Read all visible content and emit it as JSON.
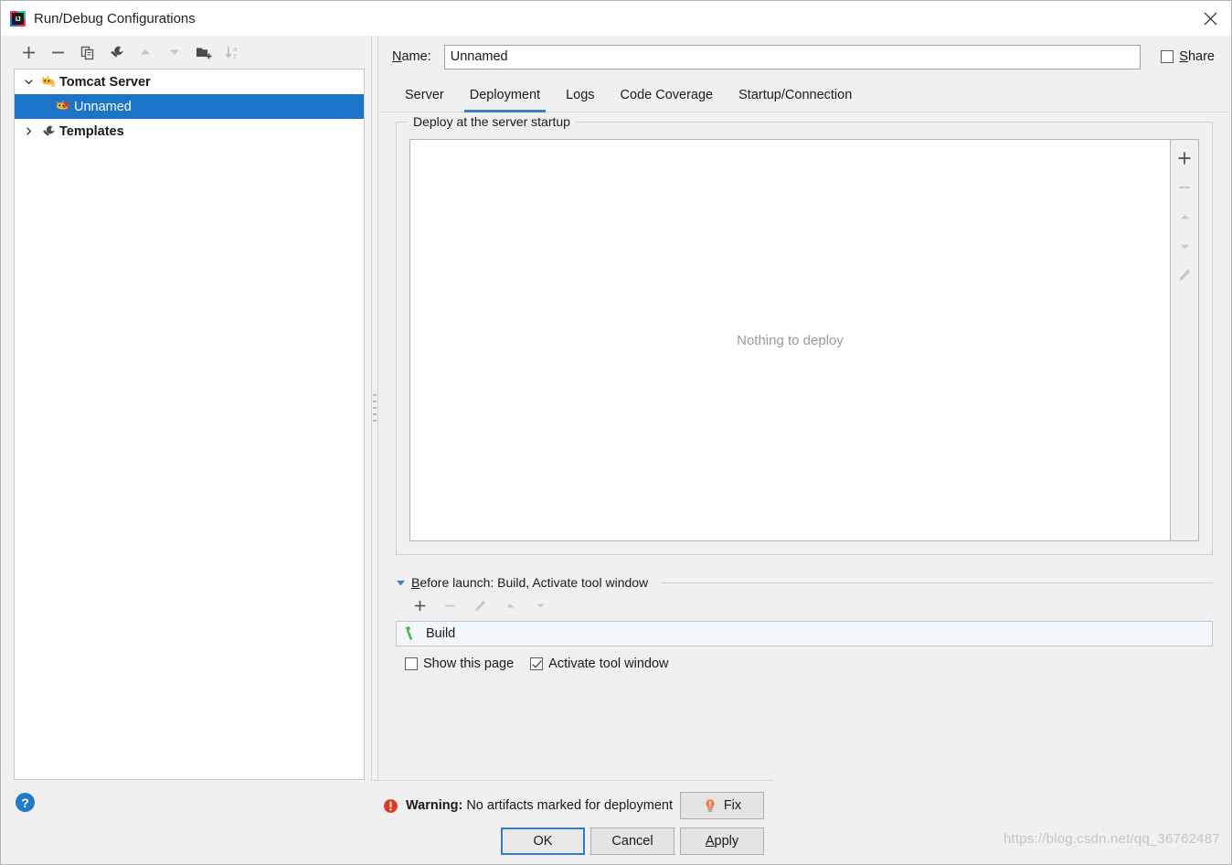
{
  "window": {
    "title": "Run/Debug Configurations",
    "app_icon": "intellij-idea-icon",
    "close_icon": "close-icon"
  },
  "left": {
    "toolbar": [
      {
        "name": "add-configuration-button",
        "icon": "plus-icon",
        "enabled": true
      },
      {
        "name": "remove-configuration-button",
        "icon": "minus-icon",
        "enabled": true
      },
      {
        "name": "copy-configuration-button",
        "icon": "copy-icon",
        "enabled": true
      },
      {
        "name": "edit-templates-button",
        "icon": "wrench-icon",
        "enabled": true
      },
      {
        "name": "move-up-button",
        "icon": "arrow-up-icon",
        "enabled": false
      },
      {
        "name": "move-down-button",
        "icon": "arrow-down-icon",
        "enabled": false
      },
      {
        "name": "new-folder-button",
        "icon": "folder-add-icon",
        "enabled": true
      },
      {
        "name": "sort-configurations-button",
        "icon": "sort-az-icon",
        "enabled": true
      }
    ],
    "tree": [
      {
        "label": "Tomcat Server",
        "icon": "tomcat-icon",
        "twisty": "expanded",
        "level": 0,
        "selected": false
      },
      {
        "label": "Unnamed",
        "icon": "tomcat-error-icon",
        "twisty": "none",
        "level": 1,
        "selected": true
      },
      {
        "label": "Templates",
        "icon": "wrench-icon",
        "twisty": "collapsed",
        "level": 0,
        "selected": false
      }
    ],
    "help_button_label": "?"
  },
  "name_row": {
    "label_prefix": "N",
    "label_rest": "ame:",
    "value": "Unnamed",
    "placeholder": "",
    "share_prefix": "S",
    "share_rest": "hare",
    "share_checked": false
  },
  "tabs": [
    {
      "label": "Server",
      "active": false
    },
    {
      "label": "Deployment",
      "active": true
    },
    {
      "label": "Logs",
      "active": false
    },
    {
      "label": "Code Coverage",
      "active": false
    },
    {
      "label": "Startup/Connection",
      "active": false
    }
  ],
  "deployment": {
    "group_title": "Deploy at the server startup",
    "empty_text": "Nothing to deploy",
    "side_toolbar": [
      {
        "name": "add-artifact-button",
        "icon": "plus-icon",
        "enabled": true
      },
      {
        "name": "remove-artifact-button",
        "icon": "minus-icon",
        "enabled": false
      },
      {
        "name": "move-artifact-up-button",
        "icon": "arrow-up-icon",
        "enabled": false
      },
      {
        "name": "move-artifact-down-button",
        "icon": "arrow-down-icon",
        "enabled": false
      },
      {
        "name": "edit-artifact-button",
        "icon": "pencil-icon",
        "enabled": false
      }
    ]
  },
  "before_launch": {
    "title_prefix": "B",
    "title_rest": "efore launch: Build, Activate tool window",
    "toolbar": [
      {
        "name": "add-before-launch-task-button",
        "icon": "plus-icon",
        "enabled": true
      },
      {
        "name": "remove-before-launch-task-button",
        "icon": "minus-icon",
        "enabled": false
      },
      {
        "name": "edit-before-launch-task-button",
        "icon": "pencil-icon",
        "enabled": false
      },
      {
        "name": "move-task-up-button",
        "icon": "arrow-up-icon",
        "enabled": false
      },
      {
        "name": "move-task-down-button",
        "icon": "arrow-down-icon",
        "enabled": false
      }
    ],
    "tasks": [
      {
        "label": "Build",
        "icon": "hammer-icon"
      }
    ],
    "checkboxes": [
      {
        "name": "show-this-page-checkbox",
        "label": "Show this page",
        "checked": false
      },
      {
        "name": "activate-tool-window-checkbox",
        "label": "Activate tool window",
        "checked": true
      }
    ]
  },
  "bottom": {
    "warning_label": "Warning:",
    "warning_message": "No artifacts marked for deployment",
    "warning_icon": "error-icon",
    "fix_button": {
      "label": "Fix",
      "icon": "lightbulb-icon"
    },
    "buttons": [
      {
        "name": "ok-button",
        "label": "OK",
        "default": true
      },
      {
        "name": "cancel-button",
        "label": "Cancel",
        "default": false
      },
      {
        "name": "apply-button",
        "label": "Apply",
        "default": false,
        "mnemonic_index": 0
      }
    ]
  },
  "watermark": "https://blog.csdn.net/qq_36762487",
  "colors": {
    "accent": "#3e7ec4",
    "selection": "#1a74c8",
    "default_button_border": "#2d7dd2",
    "error": "#db3b21",
    "build_icon": "#4fb04f",
    "panel": "#f0f0f0"
  }
}
